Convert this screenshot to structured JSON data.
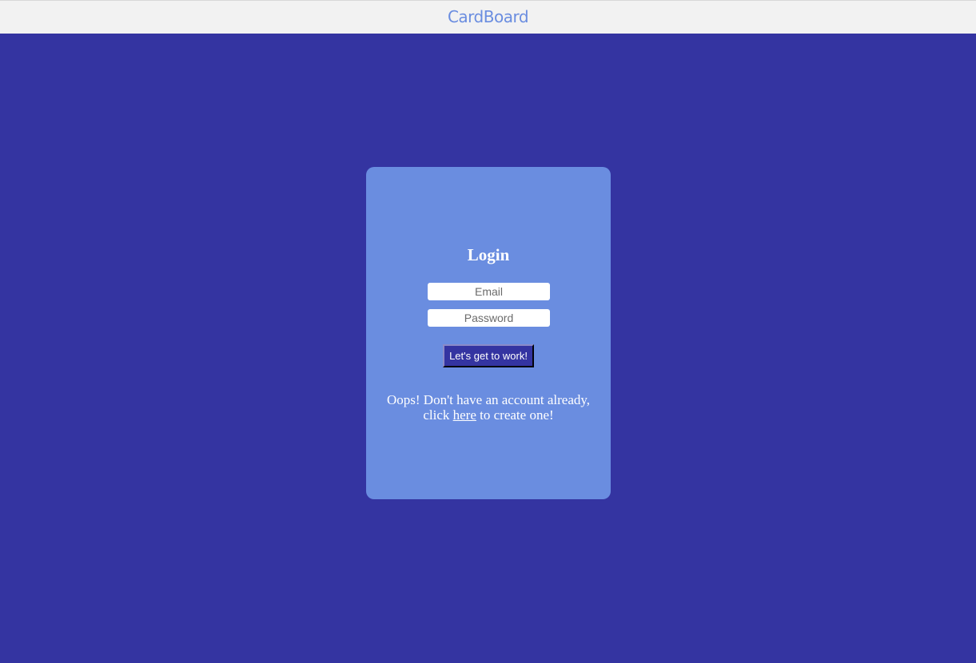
{
  "header": {
    "brand": "CardBoard"
  },
  "login": {
    "title": "Login",
    "email_placeholder": "Email",
    "password_placeholder": "Password",
    "submit_label": "Let's get to work!",
    "signup_prefix_line1": "Oops! Don't have an account already,",
    "signup_prefix_line2": "click",
    "signup_link": "here",
    "signup_suffix": "to create one!"
  },
  "colors": {
    "background": "#3434a1",
    "card": "#6a8de0",
    "header": "#f2f2f2",
    "brand": "#6a8de0"
  }
}
